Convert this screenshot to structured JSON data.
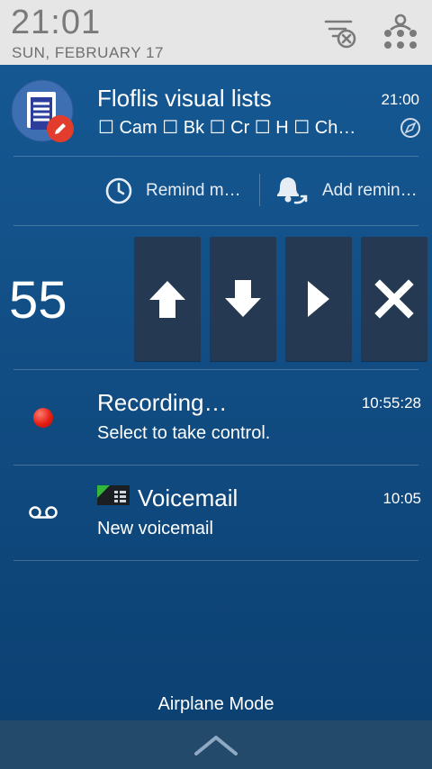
{
  "header": {
    "time": "21:01",
    "date": "SUN, FEBRUARY 17"
  },
  "notifications": {
    "floflis": {
      "title": "Floflis visual lists",
      "time": "21:00",
      "subtitle": "☐ Cam ☐ Bk ☐ Cr ☐ H ☐ Ch…",
      "actions": {
        "remind": "Remind m…",
        "add": "Add remin…"
      }
    },
    "counter": {
      "value": "55"
    },
    "recording": {
      "title": "Recording…",
      "time": "10:55:28",
      "subtitle": "Select to take control."
    },
    "voicemail": {
      "title": "Voicemail",
      "time": "10:05",
      "subtitle": "New voicemail"
    }
  },
  "footer": {
    "mode": "Airplane Mode"
  },
  "icons": {
    "clear": "clear-notifications-icon",
    "settings": "quick-settings-icon",
    "app": "document-edit-icon",
    "compass": "compass-icon",
    "clock": "clock-icon",
    "bell": "bell-snooze-icon",
    "up": "arrow-up-icon",
    "down": "arrow-down-icon",
    "play": "play-icon",
    "close": "close-icon",
    "voicemail": "voicemail-icon",
    "chevron": "chevron-up-icon"
  },
  "colors": {
    "background": "#124f86",
    "header": "#e6e6e6",
    "button": "#253a52",
    "record": "#e41e12",
    "badge": "#e23c2c"
  }
}
